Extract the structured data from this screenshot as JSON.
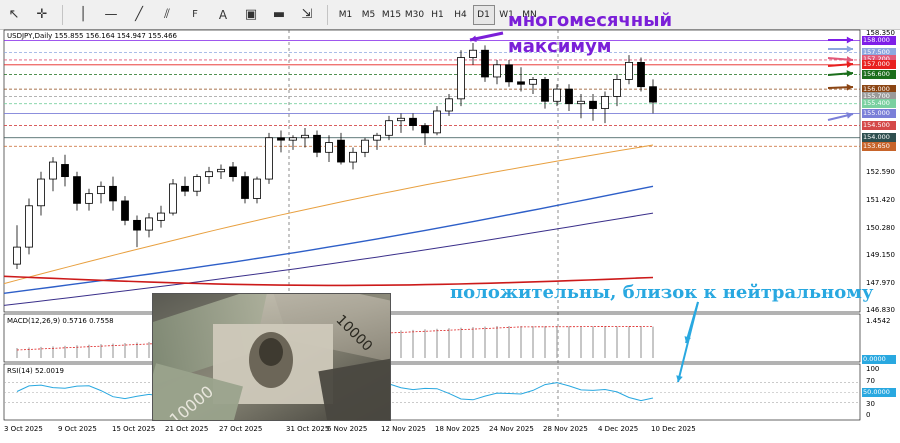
{
  "toolbar": {
    "tools": [
      "cursor",
      "crosshair",
      "hline",
      "trendline",
      "fibo",
      "text",
      "rect",
      "shapes"
    ],
    "timeframes": [
      "M1",
      "M5",
      "M15",
      "M30",
      "H1",
      "H4",
      "D1",
      "W1",
      "MN"
    ],
    "active_timeframe": "D1"
  },
  "chart": {
    "header": "USDJPY,Daily  155.855 156.164 154.947 155.466",
    "annotation_top_line1": "многомесячный",
    "annotation_top_line2": "максимум",
    "annotation_bottom": "положительны, близок к нейтральному"
  },
  "price_axis": [
    "158.350",
    "156.930",
    "155.510",
    "154.090",
    "152.590",
    "151.420",
    "150.280",
    "149.150",
    "147.970",
    "146.830"
  ],
  "price_labels": [
    {
      "text": "158.000",
      "color": "#7f1fe8"
    },
    {
      "text": "157.500",
      "color": "#8da7e0"
    },
    {
      "text": "157.200",
      "color": "#e25a7a"
    },
    {
      "text": "157.000",
      "color": "#e8201f"
    },
    {
      "text": "156.600",
      "color": "#1b6e1b"
    },
    {
      "text": "156.000",
      "color": "#8b4513"
    },
    {
      "text": "155.700",
      "color": "#9a9a9a"
    },
    {
      "text": "155.400",
      "color": "#7ad0a0"
    },
    {
      "text": "155.000",
      "color": "#7b7fd8"
    },
    {
      "text": "154.500",
      "color": "#d44848"
    },
    {
      "text": "154.000",
      "color": "#2f4f4f"
    },
    {
      "text": "153.650",
      "color": "#c7642a"
    }
  ],
  "macd": {
    "label": "MACD(12,26,9) 0.5716 0.7558",
    "axis_top": "1.4542",
    "axis_zero": "0.0000"
  },
  "rsi": {
    "label": "RSI(14) 52.0019",
    "axis": [
      "100",
      "70",
      "50.0000",
      "30",
      "0"
    ]
  },
  "dates": [
    "3 Oct 2025",
    "9 Oct 2025",
    "15 Oct 2025",
    "21 Oct 2025",
    "27 Oct 2025",
    "31 Oct 2025",
    "6 Nov 2025",
    "12 Nov 2025",
    "18 Nov 2025",
    "24 Nov 2025",
    "28 Nov 2025",
    "4 Dec 2025",
    "10 Dec 2025"
  ],
  "chart_data": {
    "type": "candlestick",
    "ohlc": [
      [
        148.8,
        150.4,
        148.6,
        149.5
      ],
      [
        149.5,
        151.5,
        149.2,
        151.2
      ],
      [
        151.2,
        152.6,
        150.8,
        152.3
      ],
      [
        152.3,
        153.2,
        151.8,
        153.0
      ],
      [
        152.9,
        153.3,
        152.0,
        152.4
      ],
      [
        152.4,
        152.6,
        151.0,
        151.3
      ],
      [
        151.3,
        151.9,
        151.0,
        151.7
      ],
      [
        151.7,
        152.2,
        151.3,
        152.0
      ],
      [
        152.0,
        152.4,
        151.0,
        151.4
      ],
      [
        151.4,
        151.6,
        150.4,
        150.6
      ],
      [
        150.6,
        150.8,
        149.5,
        150.2
      ],
      [
        150.2,
        150.9,
        149.9,
        150.7
      ],
      [
        150.6,
        151.2,
        150.3,
        150.9
      ],
      [
        150.9,
        152.3,
        150.8,
        152.1
      ],
      [
        152.0,
        152.4,
        151.6,
        151.8
      ],
      [
        151.8,
        152.5,
        151.6,
        152.4
      ],
      [
        152.4,
        152.8,
        152.1,
        152.6
      ],
      [
        152.6,
        152.9,
        152.3,
        152.7
      ],
      [
        152.8,
        153.0,
        152.2,
        152.4
      ],
      [
        152.4,
        152.6,
        151.3,
        151.5
      ],
      [
        151.5,
        152.4,
        151.3,
        152.3
      ],
      [
        152.3,
        154.2,
        152.1,
        154.0
      ],
      [
        154.0,
        154.3,
        153.4,
        153.9
      ],
      [
        153.9,
        154.1,
        153.5,
        154.0
      ],
      [
        154.0,
        154.4,
        153.6,
        154.1
      ],
      [
        154.1,
        154.3,
        153.2,
        153.4
      ],
      [
        153.4,
        154.1,
        153.0,
        153.8
      ],
      [
        153.9,
        154.2,
        152.9,
        153.0
      ],
      [
        153.0,
        153.6,
        152.7,
        153.4
      ],
      [
        153.4,
        154.0,
        153.2,
        153.9
      ],
      [
        153.9,
        154.2,
        153.5,
        154.1
      ],
      [
        154.1,
        154.9,
        153.9,
        154.7
      ],
      [
        154.7,
        155.0,
        154.2,
        154.8
      ],
      [
        154.8,
        155.0,
        154.3,
        154.5
      ],
      [
        154.5,
        154.6,
        153.7,
        154.2
      ],
      [
        154.2,
        155.3,
        154.1,
        155.1
      ],
      [
        155.1,
        155.8,
        154.9,
        155.6
      ],
      [
        155.6,
        157.6,
        155.3,
        157.3
      ],
      [
        157.3,
        157.9,
        157.0,
        157.6
      ],
      [
        157.6,
        157.8,
        156.3,
        156.5
      ],
      [
        156.5,
        157.2,
        156.2,
        157.0
      ],
      [
        157.0,
        157.2,
        156.1,
        156.3
      ],
      [
        156.3,
        156.9,
        155.9,
        156.2
      ],
      [
        156.2,
        156.5,
        155.8,
        156.4
      ],
      [
        156.4,
        156.5,
        155.2,
        155.5
      ],
      [
        155.5,
        156.2,
        155.3,
        156.0
      ],
      [
        156.0,
        156.2,
        155.1,
        155.4
      ],
      [
        155.4,
        155.8,
        154.8,
        155.5
      ],
      [
        155.5,
        155.8,
        154.7,
        155.2
      ],
      [
        155.2,
        155.9,
        154.6,
        155.7
      ],
      [
        155.7,
        156.6,
        155.3,
        156.4
      ],
      [
        156.4,
        157.4,
        156.2,
        157.1
      ],
      [
        157.1,
        157.3,
        155.9,
        156.1
      ],
      [
        156.1,
        156.4,
        155.0,
        155.466
      ]
    ],
    "ylim": [
      146.83,
      158.35
    ]
  }
}
